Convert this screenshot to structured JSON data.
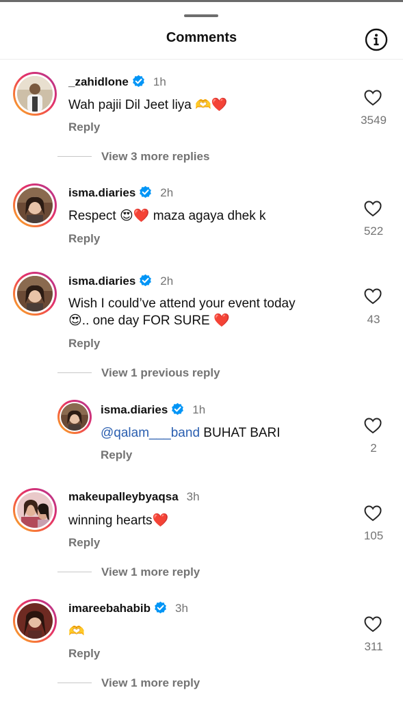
{
  "header": {
    "title": "Comments",
    "info_icon": "info-icon"
  },
  "comments": [
    {
      "username": "_zahidlone",
      "verified": true,
      "time": "1h",
      "text": "Wah pajii Dil Jeet liya 🫶❤️",
      "reply_label": "Reply",
      "likes": "3549",
      "view_replies": "View 3 more replies"
    },
    {
      "username": "isma.diaries",
      "verified": true,
      "time": "2h",
      "text": "Respect 😍❤️ maza agaya dhek k",
      "reply_label": "Reply",
      "likes": "522"
    },
    {
      "username": "isma.diaries",
      "verified": true,
      "time": "2h",
      "text_line1": "Wish I could’ve attend your event today",
      "text_line2": "😍.. one day FOR SURE ❤️",
      "reply_label": "Reply",
      "likes": "43",
      "view_replies": "View 1 previous reply"
    },
    {
      "username": "isma.diaries",
      "verified": true,
      "time": "1h",
      "mention": "@qalam___band",
      "text": " BUHAT BARI",
      "reply_label": "Reply",
      "likes": "2"
    },
    {
      "username": "makeupalleybyaqsa",
      "verified": false,
      "time": "3h",
      "text": "winning hearts❤️",
      "reply_label": "Reply",
      "likes": "105",
      "view_replies": "View 1 more reply"
    },
    {
      "username": "imareebahabib",
      "verified": true,
      "time": "3h",
      "text": "🫶",
      "reply_label": "Reply",
      "likes": "311",
      "view_replies": "View 1 more reply"
    }
  ],
  "colors": {
    "accent_blue": "#0095f6",
    "mention": "#2b5fb0",
    "muted": "#737373",
    "heart": "#e0141e"
  }
}
